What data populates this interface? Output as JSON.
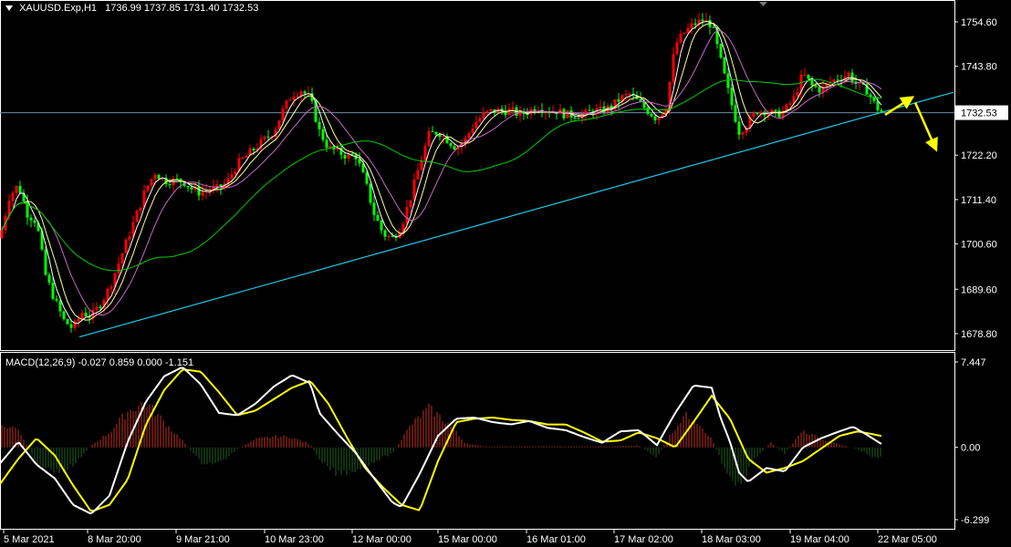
{
  "header": {
    "symbol": "XAUUSD.Exp,H1",
    "ohlc": "1736.99 1737.85 1731.40 1732.53"
  },
  "macd": {
    "label": "MACD(12,26,9) -0.027 0.859 0.000 -1.151",
    "ticks": [
      "7.447",
      "0.00",
      "-6.299"
    ]
  },
  "current_price": "1732.53",
  "colors": {
    "background": "#000000",
    "bull": "#ff0000",
    "bear": "#00ff00",
    "trendline": "#22c8e6",
    "arrow": "#ffff00",
    "ma_fast": "#ffffff",
    "ma_mid": "#ffff99",
    "ma_slow": "#cc66cc",
    "ma_long": "#00cc00",
    "macd_line": "#ffffff",
    "signal_line": "#ffff00",
    "hist_pos": "#c03020",
    "hist_neg": "#206020"
  },
  "chart_data": {
    "type": "candlestick",
    "symbol": "XAUUSD.Exp",
    "timeframe": "H1",
    "y_ticks": [
      "1754.60",
      "1743.80",
      "1733.00",
      "1722.20",
      "1711.40",
      "1700.60",
      "1689.60",
      "1678.80"
    ],
    "ylim": [
      1674.0,
      1760.0
    ],
    "x_ticks": [
      "5 Mar 2021",
      "8 Mar 20:00",
      "9 Mar 21:00",
      "10 Mar 23:00",
      "12 Mar 00:00",
      "15 Mar 00:00",
      "16 Mar 01:00",
      "17 Mar 02:00",
      "18 Mar 03:00",
      "19 Mar 04:00",
      "22 Mar 05:00"
    ],
    "price_path": [
      [
        0,
        1702
      ],
      [
        10,
        1712
      ],
      [
        20,
        1715
      ],
      [
        30,
        1708
      ],
      [
        40,
        1706
      ],
      [
        50,
        1693
      ],
      [
        60,
        1687
      ],
      [
        70,
        1682
      ],
      [
        80,
        1680
      ],
      [
        90,
        1684
      ],
      [
        100,
        1683
      ],
      [
        110,
        1686
      ],
      [
        120,
        1690
      ],
      [
        130,
        1696
      ],
      [
        140,
        1702
      ],
      [
        150,
        1708
      ],
      [
        160,
        1714
      ],
      [
        170,
        1718
      ],
      [
        180,
        1716
      ],
      [
        190,
        1716
      ],
      [
        200,
        1716
      ],
      [
        210,
        1714
      ],
      [
        220,
        1713
      ],
      [
        230,
        1714
      ],
      [
        240,
        1714
      ],
      [
        250,
        1716
      ],
      [
        260,
        1720
      ],
      [
        270,
        1722
      ],
      [
        280,
        1724
      ],
      [
        290,
        1726
      ],
      [
        300,
        1728
      ],
      [
        310,
        1733
      ],
      [
        320,
        1737
      ],
      [
        330,
        1738
      ],
      [
        340,
        1736
      ],
      [
        350,
        1728
      ],
      [
        360,
        1724
      ],
      [
        370,
        1723
      ],
      [
        380,
        1722
      ],
      [
        390,
        1722
      ],
      [
        400,
        1716
      ],
      [
        410,
        1708
      ],
      [
        420,
        1703
      ],
      [
        430,
        1702
      ],
      [
        440,
        1705
      ],
      [
        450,
        1712
      ],
      [
        460,
        1720
      ],
      [
        470,
        1727
      ],
      [
        480,
        1728
      ],
      [
        490,
        1726
      ],
      [
        500,
        1724
      ],
      [
        510,
        1726
      ],
      [
        520,
        1730
      ],
      [
        530,
        1732
      ],
      [
        540,
        1733
      ],
      [
        550,
        1733
      ],
      [
        560,
        1733
      ],
      [
        570,
        1732
      ],
      [
        580,
        1733
      ],
      [
        590,
        1734
      ],
      [
        600,
        1733
      ],
      [
        610,
        1733
      ],
      [
        620,
        1732
      ],
      [
        630,
        1732
      ],
      [
        640,
        1732
      ],
      [
        650,
        1733
      ],
      [
        660,
        1733
      ],
      [
        670,
        1734
      ],
      [
        680,
        1736
      ],
      [
        690,
        1737
      ],
      [
        700,
        1735
      ],
      [
        710,
        1733
      ],
      [
        720,
        1731
      ],
      [
        730,
        1734
      ],
      [
        740,
        1749
      ],
      [
        750,
        1752
      ],
      [
        760,
        1754
      ],
      [
        770,
        1755
      ],
      [
        780,
        1754
      ],
      [
        790,
        1745
      ],
      [
        800,
        1736
      ],
      [
        810,
        1728
      ],
      [
        820,
        1730
      ],
      [
        830,
        1733
      ],
      [
        840,
        1733
      ],
      [
        850,
        1732
      ],
      [
        860,
        1733
      ],
      [
        870,
        1736
      ],
      [
        880,
        1742
      ],
      [
        890,
        1739
      ],
      [
        900,
        1738
      ],
      [
        910,
        1740
      ],
      [
        920,
        1741
      ],
      [
        930,
        1742
      ],
      [
        940,
        1739
      ],
      [
        950,
        1738
      ],
      [
        960,
        1734
      ],
      [
        967,
        1732.53
      ]
    ],
    "moving_averages": [
      {
        "color": "ma_fast",
        "smoothing": 3
      },
      {
        "color": "ma_mid",
        "smoothing": 6
      },
      {
        "color": "ma_slow",
        "smoothing": 12
      },
      {
        "color": "ma_long",
        "smoothing": 40
      }
    ],
    "trendline": {
      "from": [
        87,
        1678.0
      ],
      "to": [
        1045,
        1737.5
      ]
    },
    "horizontal_line": 1732.53,
    "arrows": [
      {
        "from": [
          970,
          1732
        ],
        "to": [
          998,
          1736
        ]
      },
      {
        "from": [
          1003,
          1735
        ],
        "to": [
          1025,
          1724
        ]
      }
    ],
    "macd": {
      "ylim": [
        -6.299,
        7.447
      ],
      "zero": 0.0,
      "macd_path": [
        [
          0,
          -1.4
        ],
        [
          20,
          0.5
        ],
        [
          40,
          -1.5
        ],
        [
          60,
          -2.7
        ],
        [
          80,
          -5.0
        ],
        [
          100,
          -5.8
        ],
        [
          120,
          -4.2
        ],
        [
          140,
          0.5
        ],
        [
          160,
          4.0
        ],
        [
          180,
          6.2
        ],
        [
          200,
          7.0
        ],
        [
          220,
          5.5
        ],
        [
          240,
          3.0
        ],
        [
          260,
          2.8
        ],
        [
          280,
          3.8
        ],
        [
          300,
          5.3
        ],
        [
          320,
          6.3
        ],
        [
          340,
          5.6
        ],
        [
          350,
          3.0
        ],
        [
          370,
          1.2
        ],
        [
          390,
          -0.5
        ],
        [
          410,
          -2.7
        ],
        [
          430,
          -4.8
        ],
        [
          440,
          -5.2
        ],
        [
          460,
          -2.3
        ],
        [
          480,
          1.0
        ],
        [
          500,
          2.5
        ],
        [
          520,
          2.6
        ],
        [
          540,
          2.2
        ],
        [
          560,
          2.0
        ],
        [
          580,
          2.3
        ],
        [
          600,
          1.7
        ],
        [
          620,
          1.5
        ],
        [
          640,
          0.9
        ],
        [
          660,
          0.4
        ],
        [
          680,
          1.4
        ],
        [
          700,
          1.5
        ],
        [
          720,
          0.2
        ],
        [
          740,
          3.0
        ],
        [
          760,
          5.4
        ],
        [
          780,
          5.2
        ],
        [
          790,
          2.5
        ],
        [
          800,
          0.5
        ],
        [
          810,
          -2.2
        ],
        [
          820,
          -3.0
        ],
        [
          840,
          -1.8
        ],
        [
          860,
          -2.1
        ],
        [
          880,
          0.0
        ],
        [
          900,
          0.8
        ],
        [
          920,
          1.4
        ],
        [
          935,
          1.8
        ],
        [
          950,
          1.1
        ],
        [
          966,
          0.3
        ]
      ],
      "signal_path": [
        [
          0,
          -3.2
        ],
        [
          20,
          -1.0
        ],
        [
          40,
          0.8
        ],
        [
          60,
          -0.7
        ],
        [
          80,
          -3.3
        ],
        [
          100,
          -5.6
        ],
        [
          120,
          -5.0
        ],
        [
          140,
          -2.8
        ],
        [
          160,
          2.0
        ],
        [
          180,
          5.0
        ],
        [
          200,
          6.8
        ],
        [
          220,
          6.6
        ],
        [
          240,
          4.8
        ],
        [
          260,
          2.8
        ],
        [
          280,
          3.2
        ],
        [
          300,
          4.2
        ],
        [
          320,
          5.2
        ],
        [
          340,
          5.8
        ],
        [
          360,
          3.8
        ],
        [
          380,
          0.9
        ],
        [
          400,
          -1.8
        ],
        [
          420,
          -3.5
        ],
        [
          440,
          -5.0
        ],
        [
          460,
          -5.5
        ],
        [
          480,
          -1.2
        ],
        [
          500,
          2.2
        ],
        [
          520,
          2.5
        ],
        [
          540,
          2.6
        ],
        [
          560,
          2.4
        ],
        [
          580,
          2.3
        ],
        [
          600,
          2.0
        ],
        [
          620,
          2.0
        ],
        [
          640,
          1.3
        ],
        [
          660,
          0.5
        ],
        [
          680,
          0.6
        ],
        [
          700,
          1.3
        ],
        [
          720,
          0.8
        ],
        [
          740,
          0.0
        ],
        [
          760,
          2.2
        ],
        [
          780,
          4.5
        ],
        [
          800,
          2.5
        ],
        [
          820,
          -1.0
        ],
        [
          840,
          -2.2
        ],
        [
          860,
          -1.8
        ],
        [
          880,
          -1.2
        ],
        [
          900,
          -0.1
        ],
        [
          920,
          1.0
        ],
        [
          940,
          1.4
        ],
        [
          966,
          1.0
        ]
      ],
      "histogram_envelope": [
        [
          0,
          2.1
        ],
        [
          20,
          1.9
        ],
        [
          40,
          -1.8
        ],
        [
          60,
          -2.4
        ],
        [
          80,
          -1.8
        ],
        [
          100,
          0.2
        ],
        [
          120,
          1.5
        ],
        [
          140,
          3.6
        ],
        [
          160,
          4.5
        ],
        [
          180,
          2.5
        ],
        [
          200,
          0.7
        ],
        [
          220,
          -1.5
        ],
        [
          240,
          -1.6
        ],
        [
          260,
          -0.2
        ],
        [
          280,
          0.8
        ],
        [
          300,
          1.1
        ],
        [
          320,
          1.0
        ],
        [
          340,
          0.3
        ],
        [
          350,
          -1.3
        ],
        [
          370,
          -2.7
        ],
        [
          390,
          -2.2
        ],
        [
          410,
          -1.4
        ],
        [
          430,
          -0.6
        ],
        [
          450,
          2.2
        ],
        [
          470,
          3.9
        ],
        [
          490,
          2.5
        ],
        [
          510,
          0.4
        ],
        [
          530,
          0.1
        ],
        [
          560,
          0.1
        ],
        [
          600,
          0.1
        ],
        [
          640,
          0.1
        ],
        [
          670,
          0.1
        ],
        [
          700,
          0.2
        ],
        [
          720,
          -1.0
        ],
        [
          735,
          1.3
        ],
        [
          750,
          3.2
        ],
        [
          765,
          2.6
        ],
        [
          780,
          0.8
        ],
        [
          795,
          -2.2
        ],
        [
          810,
          -3.8
        ],
        [
          825,
          -1.3
        ],
        [
          845,
          0.5
        ],
        [
          860,
          -0.6
        ],
        [
          880,
          1.7
        ],
        [
          900,
          0.8
        ],
        [
          920,
          0.3
        ],
        [
          940,
          -0.2
        ],
        [
          955,
          -0.9
        ],
        [
          966,
          -1.0
        ]
      ]
    }
  }
}
